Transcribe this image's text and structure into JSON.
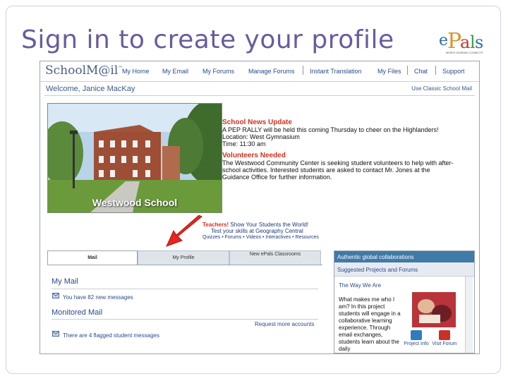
{
  "slide": {
    "title": "Sign in to create your profile",
    "logo_text": "ePals",
    "logo_tagline": "WHERE LEARNING CONNECTS"
  },
  "app": {
    "logo": "SchoolM@il",
    "logo_tm": "™",
    "nav": [
      "My Home",
      "My Email",
      "My Forums",
      "Manage Forums",
      "Instant Translation",
      "My Files",
      "Chat",
      "Support"
    ],
    "welcome": "Welcome, Janice MacKay",
    "classic_link": "Use Classic School Mail"
  },
  "feature": {
    "photo_label": "Westwood School",
    "news_title": "School News Update",
    "news_lines": [
      "A PEP RALLY will be held this coming Thursday to cheer on the Highlanders!",
      "Location: West Gymnasium",
      "Time: 11:30 am"
    ],
    "volunteers_title": "Volunteers Needed",
    "volunteers_lines": [
      "The Westwood Community Center is seeking student volunteers to help with after-",
      "school activities. Interested students are asked to contact Mr. Jones at the",
      "Guidance Office for further information."
    ]
  },
  "teachers": {
    "line1_hd": "Teachers!",
    "line1_rest": " Show Your Students the World!",
    "line2": "Test your skills at Geography Central",
    "line3": "Quizzes • Forums • Videos • Interactives • Resources"
  },
  "tabs": [
    {
      "label": "Mail"
    },
    {
      "label": "My Profile"
    },
    {
      "label": "New ePals Classrooms"
    }
  ],
  "mail": {
    "my_mail_title": "My Mail",
    "new_messages": "You have 82 new messages",
    "monitored_title": "Monitored Mail",
    "request_link": "Request more accounts",
    "flagged": "There are 4 flagged student messages"
  },
  "right_panel": {
    "header": "Authentic global collaborations",
    "subheader": "Suggested Projects and Forums",
    "project_link": "The Way We Are",
    "description": "What makes me who I am? In this project students will engage in a collaborative learning experience. Through email exchanges, students learn about the daily",
    "btn1": "Project Info",
    "btn2": "Visit Forum"
  },
  "colors": {
    "title": "#6a5b9e",
    "nav": "#2b4a8c",
    "accent_red": "#d0311f",
    "panel_header": "#3f7aa8"
  }
}
